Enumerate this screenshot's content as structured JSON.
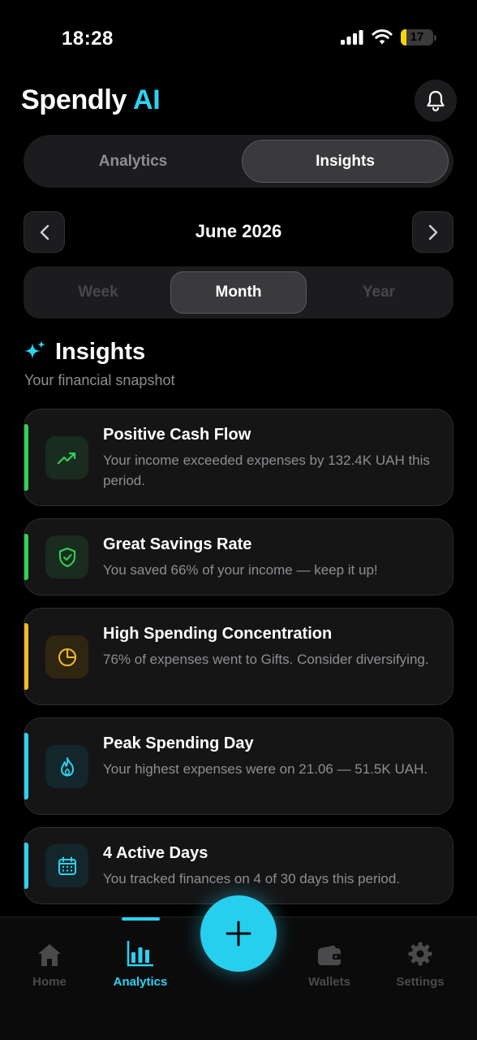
{
  "status_bar": {
    "time": "18:28",
    "battery": "17"
  },
  "header": {
    "brand": "Spendly",
    "brand_accent": "AI"
  },
  "main_tabs": [
    {
      "label": "Analytics",
      "selected": false
    },
    {
      "label": "Insights",
      "selected": true
    }
  ],
  "period_nav": {
    "label": "June 2026"
  },
  "period_tabs": [
    {
      "label": "Week",
      "selected": false
    },
    {
      "label": "Month",
      "selected": true
    },
    {
      "label": "Year",
      "selected": false
    }
  ],
  "section": {
    "title": "Insights",
    "subtitle": "Your financial snapshot"
  },
  "insights": [
    {
      "title": "Positive Cash Flow",
      "description": "Your income exceeded expenses by 132.4K UAH this period.",
      "icon": "trending-up-icon",
      "accent": "#30d158"
    },
    {
      "title": "Great Savings Rate",
      "description": "You saved 66% of your income — keep it up!",
      "icon": "shield-check-icon",
      "accent": "#30d158"
    },
    {
      "title": "High Spending Concentration",
      "description": "76% of expenses went to Gifts. Consider diversifying.",
      "icon": "pie-chart-icon",
      "accent": "#f5b921"
    },
    {
      "title": "Peak Spending Day",
      "description": "Your highest expenses were on 21.06 — 51.5K UAH.",
      "icon": "flame-icon",
      "accent": "#2bd3f2"
    },
    {
      "title": "4 Active Days",
      "description": "You tracked finances on 4 of 30 days this period.",
      "icon": "calendar-icon",
      "accent": "#2bd3f2"
    }
  ],
  "bottom_nav": [
    {
      "label": "Home",
      "icon": "home-icon",
      "active": false
    },
    {
      "label": "Analytics",
      "icon": "bar-chart-icon",
      "active": true
    },
    {
      "label": "Wallets",
      "icon": "wallet-icon",
      "active": false
    },
    {
      "label": "Settings",
      "icon": "gear-icon",
      "active": false
    }
  ],
  "colors": {
    "accent": "#2bd3f2",
    "background": "#000000",
    "card": "#151516"
  }
}
